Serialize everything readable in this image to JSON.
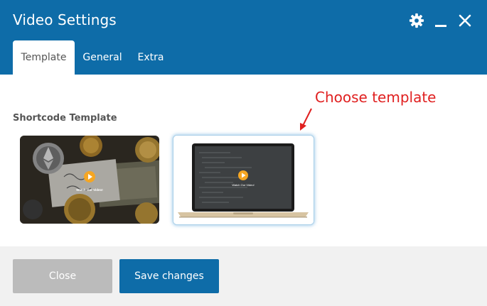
{
  "dialog": {
    "title": "Video Settings",
    "icons": [
      "gear-icon",
      "minimize-icon",
      "close-icon"
    ]
  },
  "tabs": [
    {
      "label": "Template",
      "active": true
    },
    {
      "label": "General",
      "active": false
    },
    {
      "label": "Extra",
      "active": false
    }
  ],
  "content": {
    "section_label": "Shortcode Template",
    "annotation": "Choose template",
    "templates": [
      {
        "name": "template-crypto",
        "caption": "Watch Our Video!",
        "selected": false
      },
      {
        "name": "template-laptop",
        "caption": "Watch Our Video!",
        "selected": true
      }
    ]
  },
  "footer": {
    "close_label": "Close",
    "save_label": "Save changes"
  },
  "colors": {
    "header": "#0e6ca8",
    "primary_button": "#0e6ca8",
    "disabled_button": "#bbbbbb",
    "footer_bg": "#f1f1f1",
    "annotation": "#e02020",
    "play_button": "#f5a623"
  }
}
